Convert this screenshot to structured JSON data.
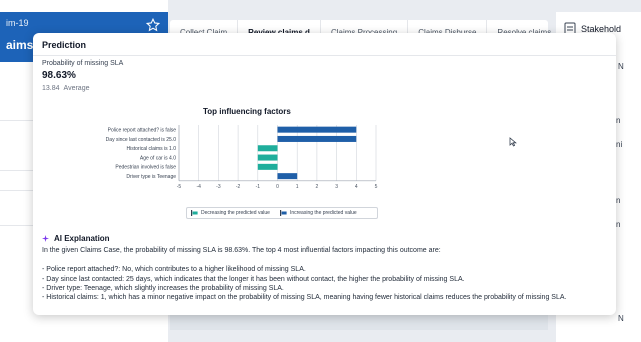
{
  "case": {
    "id": "im-19",
    "name": "aims"
  },
  "stages": [
    "Collect Claim",
    "Review claims d",
    "Claims Processing",
    "Claims Disburse",
    "Resolve claims"
  ],
  "right_panel": {
    "label": "Stakehold",
    "edge_letters": [
      "N",
      "n",
      "ni",
      "n",
      "n",
      "N"
    ]
  },
  "popover": {
    "title": "Prediction",
    "metric_label": "Probability of missing SLA",
    "metric_value": "98.63%",
    "average_value": "13.84",
    "average_label": "Average"
  },
  "chart_data": {
    "type": "bar",
    "orientation": "horizontal",
    "title": "Top influencing factors",
    "categories": [
      "Police report attached? is false",
      "Day since last contacted is 25.0",
      "Historical claims is 1.0",
      "Age of car is 4.0",
      "Pedestrian involved is false",
      "Driver type is Teenage"
    ],
    "values": [
      4,
      4,
      -1,
      -1,
      -1,
      1
    ],
    "xlim": [
      -5,
      5
    ],
    "xticks": [
      -5,
      -4,
      -3,
      -2,
      -1,
      0,
      1,
      2,
      3,
      4,
      5
    ],
    "grid": true,
    "colors": {
      "increasing": "#1f5fa8",
      "decreasing": "#1fae9c"
    },
    "legend": {
      "placement": "bottom",
      "decreasing": "Decreasing the predicted value",
      "increasing": "Increasing the predicted value"
    }
  },
  "ai": {
    "title": "AI Explanation",
    "intro": "In the given Claims Case, the probability of missing SLA is 98.63%. The top 4 most influential factors impacting this outcome are:",
    "items": [
      "- Police report attached?: No, which contributes to a higher likelihood of missing SLA.",
      "- Day since last contacted: 25 days, which indicates that the longer it has been without contact, the higher the probability of missing SLA.",
      "- Driver type: Teenage, which slightly increases the probability of missing SLA.",
      "- Historical claims: 1, which has a minor negative impact on the probability of missing SLA, meaning having fewer historical claims reduces the probability of missing SLA."
    ]
  }
}
